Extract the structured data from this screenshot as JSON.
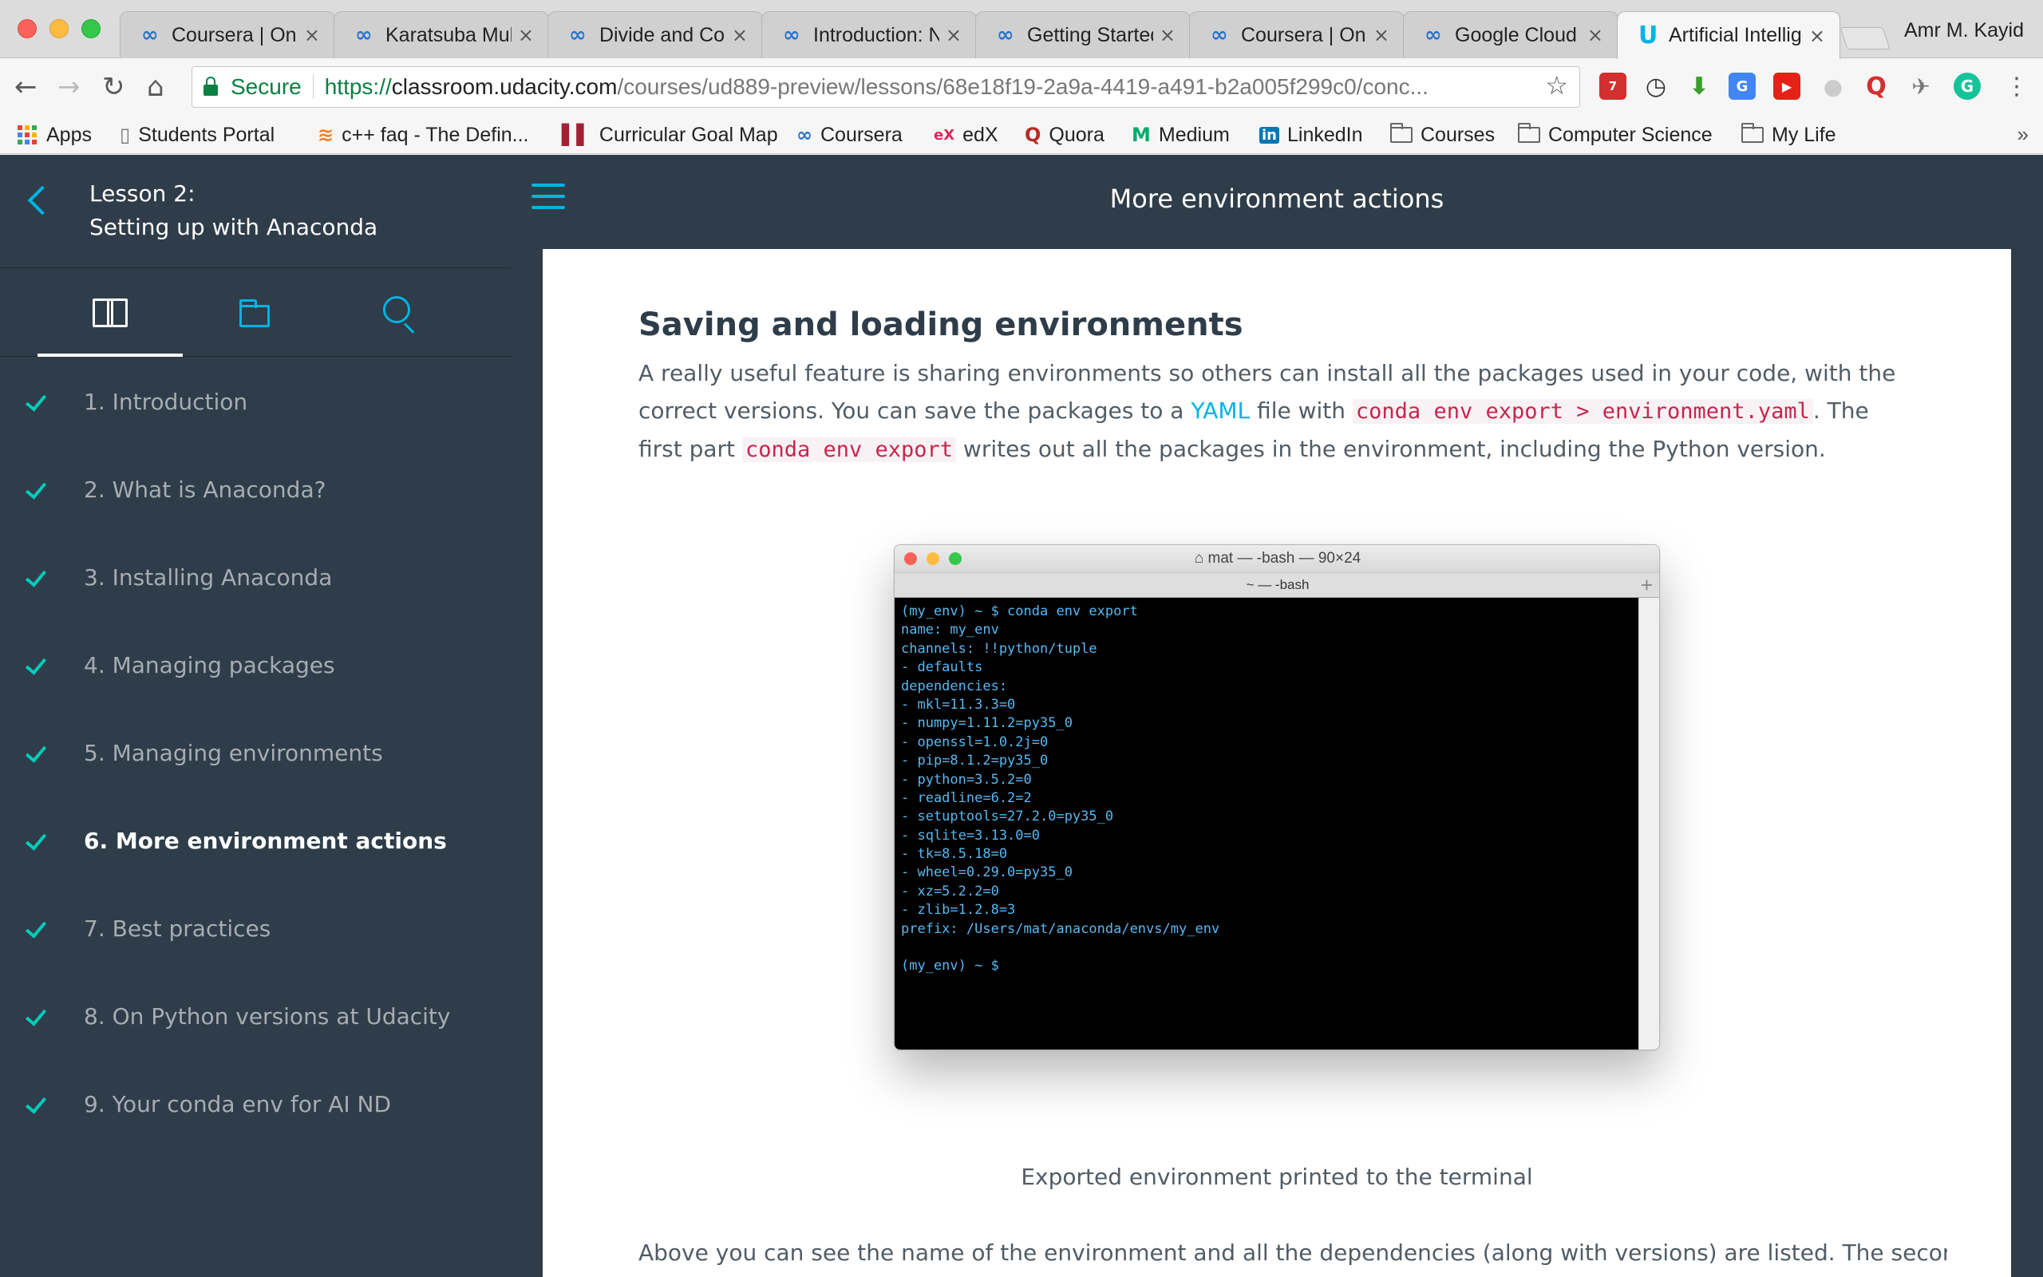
{
  "browser": {
    "tabs": [
      {
        "label": "Coursera | Online Courses",
        "favicon": "coursera-icon"
      },
      {
        "label": "Karatsuba Multiplication",
        "favicon": "coursera-icon"
      },
      {
        "label": "Divide and Conquer",
        "favicon": "coursera-icon"
      },
      {
        "label": "Introduction: Neural Networks",
        "favicon": "coursera-icon"
      },
      {
        "label": "Getting Started",
        "favicon": "coursera-icon"
      },
      {
        "label": "Coursera | Online Courses",
        "favicon": "coursera-icon"
      },
      {
        "label": "Google Cloud",
        "favicon": "coursera-icon"
      },
      {
        "label": "Artificial Intelligence",
        "favicon": "udacity-icon",
        "active": true
      }
    ],
    "profile_name": "Amr M. Kayid",
    "secure_label": "Secure",
    "url_scheme": "https://",
    "url_host": "classroom.udacity.com",
    "url_path": "/courses/ud889-preview/lessons/68e18f19-2a9a-4419-a491-b2a005f299c0/conc...",
    "extension_badge": "7",
    "bookmarks": [
      {
        "label": "Apps",
        "icon": "apps-grid-icon"
      },
      {
        "label": "Students Portal",
        "icon": "page-icon"
      },
      {
        "label": "c++ faq - The Defin...",
        "icon": "stackoverflow-icon"
      },
      {
        "label": "Curricular Goal Map",
        "icon": "goal-map-icon"
      },
      {
        "label": "Coursera",
        "icon": "coursera-icon"
      },
      {
        "label": "edX",
        "icon": "edx-icon"
      },
      {
        "label": "Quora",
        "icon": "quora-icon"
      },
      {
        "label": "Medium",
        "icon": "medium-icon"
      },
      {
        "label": "LinkedIn",
        "icon": "linkedin-icon"
      },
      {
        "label": "Courses",
        "icon": "folder-icon"
      },
      {
        "label": "Computer Science",
        "icon": "folder-icon"
      },
      {
        "label": "My Life",
        "icon": "folder-icon"
      }
    ],
    "overflow_label": "»"
  },
  "sidebar": {
    "lesson_number": "Lesson 2:",
    "lesson_title": "Setting up with Anaconda",
    "concepts": [
      {
        "label": "1. Introduction",
        "done": true
      },
      {
        "label": "2. What is Anaconda?",
        "done": true
      },
      {
        "label": "3. Installing Anaconda",
        "done": true
      },
      {
        "label": "4. Managing packages",
        "done": true
      },
      {
        "label": "5. Managing environments",
        "done": true
      },
      {
        "label": "6. More environment actions",
        "done": true,
        "active": true
      },
      {
        "label": "7. Best practices",
        "done": true
      },
      {
        "label": "8. On Python versions at Udacity",
        "done": true
      },
      {
        "label": "9. Your conda env for AI ND",
        "done": true
      }
    ]
  },
  "header": {
    "title": "More environment actions"
  },
  "content": {
    "heading": "Saving and loading environments",
    "p1_a": "A really useful feature is sharing environments so others can install all the packages used in your code, with the correct versions. You can save the packages to a ",
    "p1_link": "YAML",
    "p1_b": " file with ",
    "p1_code1": "conda env export > environment.yaml",
    "p1_c": ". The first part ",
    "p1_code2": "conda env export",
    "p1_d": " writes out all the packages in the environment, including the Python version.",
    "terminal": {
      "title": "mat — -bash — 90×24",
      "tab": "~ — -bash",
      "lines": [
        "(my_env) ~ $ conda env export",
        "name: my_env",
        "channels: !!python/tuple",
        "- defaults",
        "dependencies:",
        "- mkl=11.3.3=0",
        "- numpy=1.11.2=py35_0",
        "- openssl=1.0.2j=0",
        "- pip=8.1.2=py35_0",
        "- python=3.5.2=0",
        "- readline=6.2=2",
        "- setuptools=27.2.0=py35_0",
        "- sqlite=3.13.0=0",
        "- tk=8.5.18=0",
        "- wheel=0.29.0=py35_0",
        "- xz=5.2.2=0",
        "- zlib=1.2.8=3",
        "prefix: /Users/mat/anaconda/envs/my_env",
        "",
        "(my_env) ~ $"
      ]
    },
    "caption": "Exported environment printed to the terminal",
    "p2": "Above you can see the name of the environment and all the dependencies (along with versions) are listed. The second part"
  },
  "colors": {
    "accent": "#02b3e4",
    "check": "#02ccba",
    "sidebar_bg": "#2e3d49",
    "code": "#c7254e",
    "terminal_text": "#58b8f2"
  }
}
